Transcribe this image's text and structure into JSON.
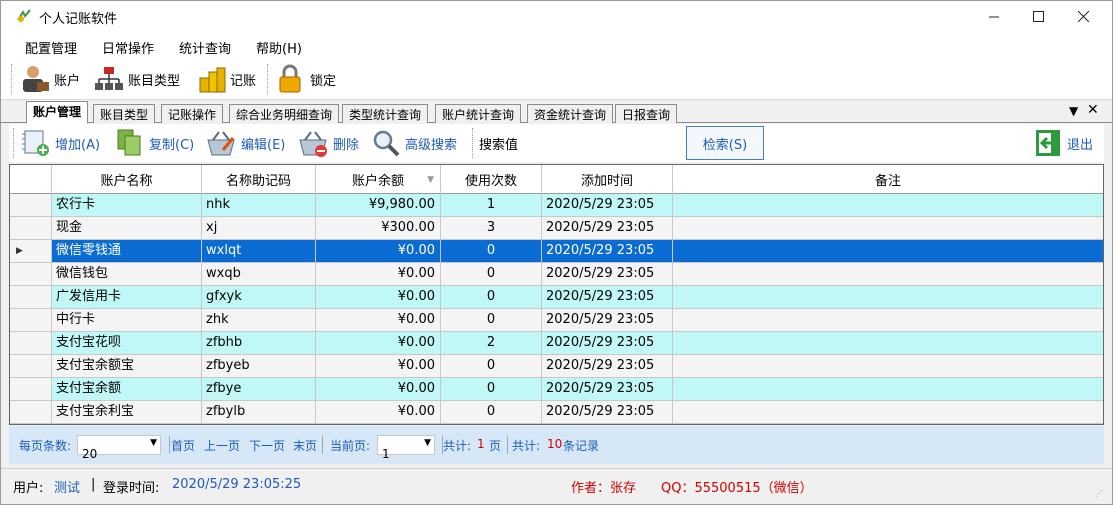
{
  "window": {
    "title": "个人记账软件"
  },
  "menu": [
    "配置管理",
    "日常操作",
    "统计查询",
    "帮助(H)"
  ],
  "toolbar": {
    "account": "账户",
    "account_type": "账目类型",
    "bookkeeping": "记账",
    "lock": "锁定"
  },
  "tabs": [
    "账户管理",
    "账目类型",
    "记账操作",
    "综合业务明细查询",
    "类型统计查询",
    "账户统计查询",
    "资金统计查询",
    "日报查询"
  ],
  "subbar": {
    "add": "增加(A)",
    "copy": "复制(C)",
    "edit": "编辑(E)",
    "delete": "删除",
    "advanced_search": "高级搜索",
    "search_value_label": "搜索值",
    "search_button": "检索(S)",
    "exit": "退出"
  },
  "grid": {
    "columns": [
      "账户名称",
      "名称助记码",
      "账户余额",
      "使用次数",
      "添加时间",
      "备注"
    ],
    "rows": [
      {
        "name": "农行卡",
        "code": "nhk",
        "balance": "¥9,980.00",
        "count": "1",
        "time": "2020/5/29 23:05",
        "note": ""
      },
      {
        "name": "现金",
        "code": "xj",
        "balance": "¥300.00",
        "count": "3",
        "time": "2020/5/29 23:05",
        "note": ""
      },
      {
        "name": "微信零钱通",
        "code": "wxlqt",
        "balance": "¥0.00",
        "count": "0",
        "time": "2020/5/29 23:05",
        "note": ""
      },
      {
        "name": "微信钱包",
        "code": "wxqb",
        "balance": "¥0.00",
        "count": "0",
        "time": "2020/5/29 23:05",
        "note": ""
      },
      {
        "name": "广发信用卡",
        "code": "gfxyk",
        "balance": "¥0.00",
        "count": "0",
        "time": "2020/5/29 23:05",
        "note": ""
      },
      {
        "name": "中行卡",
        "code": "zhk",
        "balance": "¥0.00",
        "count": "0",
        "time": "2020/5/29 23:05",
        "note": ""
      },
      {
        "name": "支付宝花呗",
        "code": "zfbhb",
        "balance": "¥0.00",
        "count": "2",
        "time": "2020/5/29 23:05",
        "note": ""
      },
      {
        "name": "支付宝余额宝",
        "code": "zfbyeb",
        "balance": "¥0.00",
        "count": "0",
        "time": "2020/5/29 23:05",
        "note": ""
      },
      {
        "name": "支付宝余额",
        "code": "zfbye",
        "balance": "¥0.00",
        "count": "0",
        "time": "2020/5/29 23:05",
        "note": ""
      },
      {
        "name": "支付宝余利宝",
        "code": "zfbylb",
        "balance": "¥0.00",
        "count": "0",
        "time": "2020/5/29 23:05",
        "note": ""
      }
    ],
    "selected_index": 2
  },
  "pager": {
    "page_size_label": "每页条数:",
    "page_size": "20",
    "first": "首页",
    "prev": "上一页",
    "next": "下一页",
    "last": "末页",
    "current_label": "当前页:",
    "current": "1",
    "total_label": "共计:",
    "total_pages": "1",
    "pages_unit": "页",
    "total_label2": "共计:",
    "total_records": "10",
    "records_unit": "条记录"
  },
  "status": {
    "user_label": "用户:",
    "user": "测试",
    "sep": "|",
    "login_label": "登录时间:",
    "login_time": "2020/5/29 23:05:25",
    "author": "作者：张存",
    "qq": "QQ：55500515（微信）"
  },
  "colors": {
    "selected_row": "#0a6cd2",
    "alt_row": "#c0f7f7",
    "link_blue": "#1d5bb8",
    "status_red": "#d40000"
  }
}
